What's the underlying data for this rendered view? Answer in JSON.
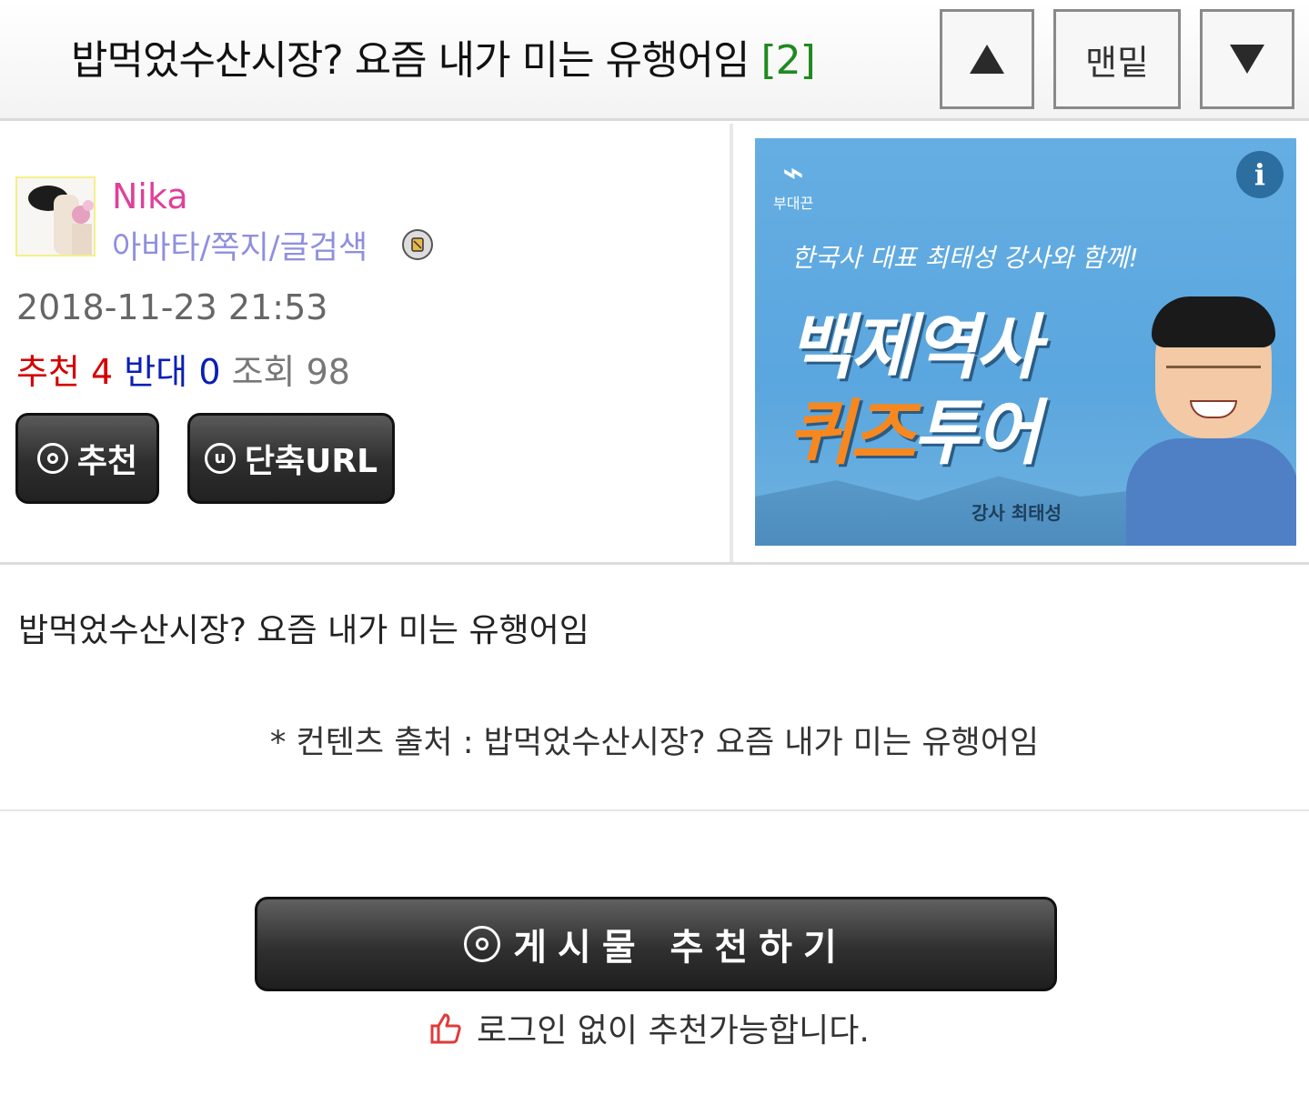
{
  "header": {
    "title": "밥먹었수산시장? 요즘 내가 미는 유행어임",
    "comment_count": "[2]",
    "bottom_label": "맨밑"
  },
  "author": {
    "name": "Nika",
    "links": "아바타/쪽지/글검색",
    "date": "2018-11-23 21:53",
    "recommend_label": "추천",
    "recommend_count": "4",
    "oppose_label": "반대",
    "oppose_count": "0",
    "views_label": "조회",
    "views_count": "98"
  },
  "buttons": {
    "recommend": "추천",
    "short_url": "단축URL",
    "recommend_post": "게시물 추천하기"
  },
  "ad": {
    "brand": "부대끈",
    "subtitle": "한국사 대표 최태성 강사와 함께!",
    "line1": "백제역사",
    "line2_orange": "퀴즈",
    "line2_white": "투어",
    "teacher": "강사 최태성",
    "info_icon": "i"
  },
  "post": {
    "body": "밥먹었수산시장? 요즘 내가 미는 유행어임",
    "source": "* 컨텐츠 출처 : 밥먹었수산시장? 요즘 내가 미는 유행어임",
    "login_note": "로그인 없이 추천가능합니다."
  },
  "colors": {
    "username": "#e0409a",
    "links": "#8f8fdf",
    "recommend": "#d40000",
    "oppose": "#0a1fb5",
    "comment_count": "#1f8a1f",
    "ad_orange": "#f7881f"
  },
  "icons": [
    "arrow-up-icon",
    "arrow-down-icon",
    "medal-icon",
    "target-icon",
    "url-icon",
    "info-icon",
    "thumbs-up-icon"
  ]
}
